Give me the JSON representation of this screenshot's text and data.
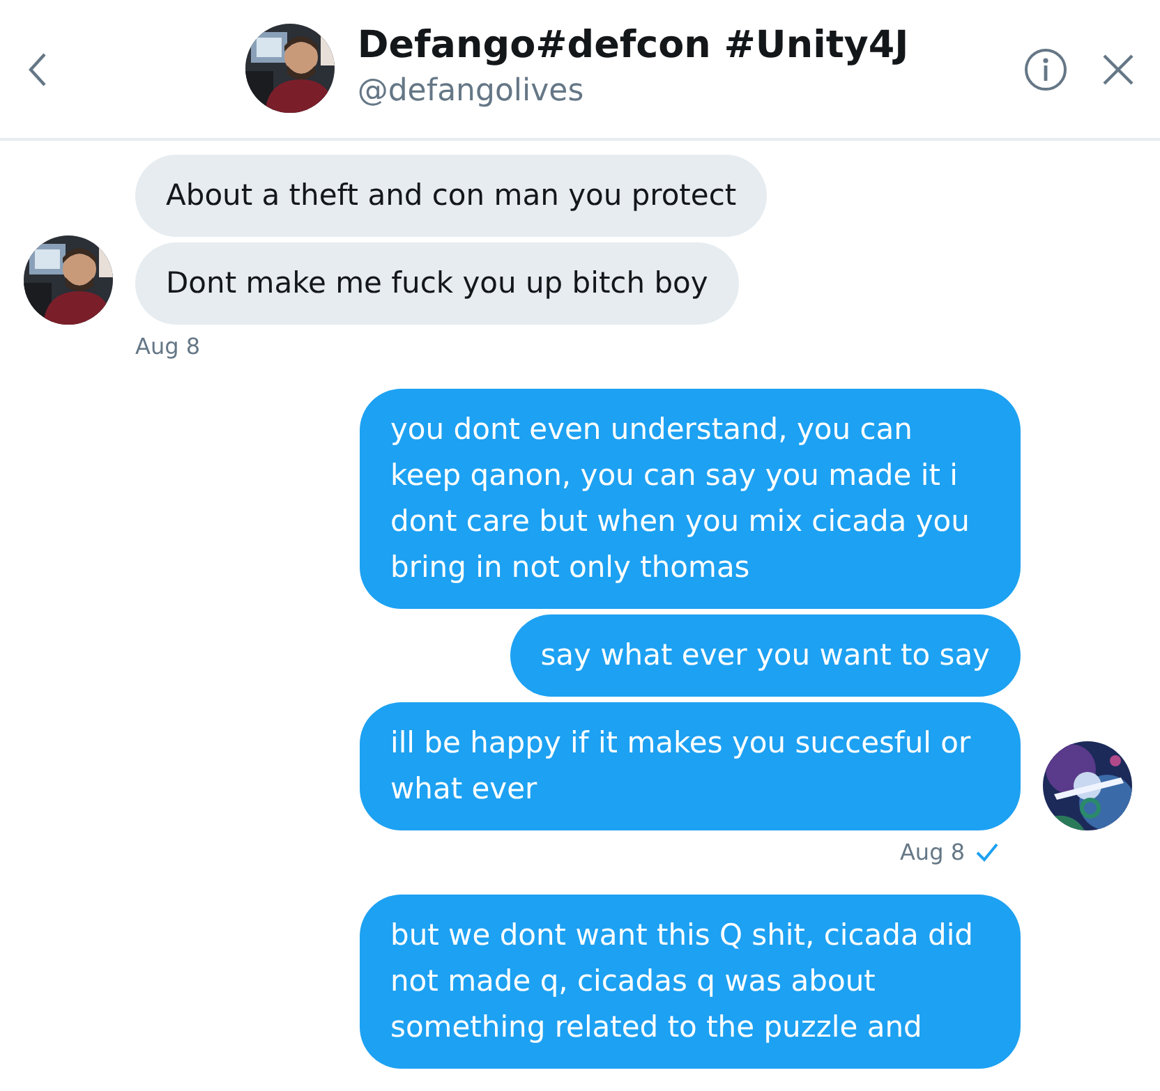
{
  "header": {
    "title": "Defango#defcon #Unity4J",
    "handle": "@defangolives"
  },
  "groups": [
    {
      "kind": "received",
      "bubbles": [
        "About a theft and con man you protect",
        "Dont make me fuck you up bitch boy"
      ],
      "timestamp": "Aug 8"
    },
    {
      "kind": "sent",
      "bubbles": [
        "you dont even understand, you can keep qanon, you can say you made it i dont care but when you mix cicada you bring in not only thomas",
        "say what ever you want to say",
        "ill be happy if it makes you succesful or what ever"
      ],
      "timestamp": "Aug 8",
      "read": true
    },
    {
      "kind": "sent",
      "bubbles": [
        "but we dont want this Q shit, cicada did not made q, cicadas q was about something related to the puzzle and"
      ]
    }
  ]
}
